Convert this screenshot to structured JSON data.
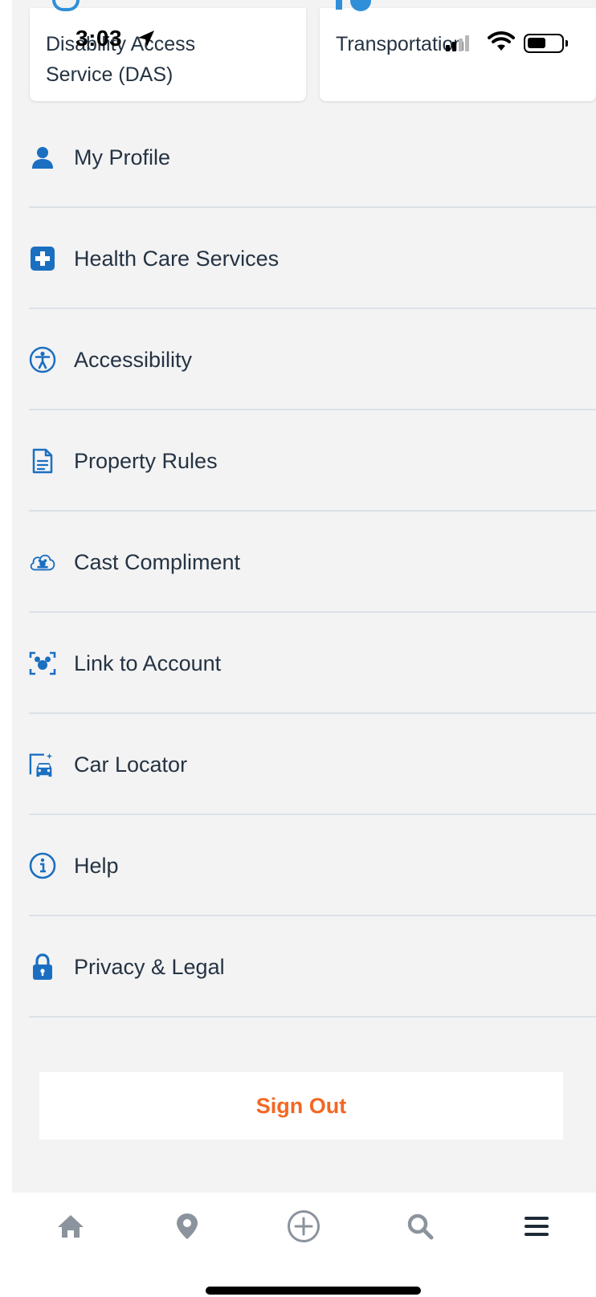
{
  "cards": {
    "das_label": "Disability Access Service (DAS)",
    "transportation_label": "Transportation"
  },
  "status_bar": {
    "time": "3:03"
  },
  "colors": {
    "accent_blue": "#1b6fc1",
    "sign_out_orange": "#f26722",
    "text_dark": "#253342",
    "background": "#f3f3f4"
  },
  "menu": {
    "items": [
      {
        "label": "My Profile",
        "icon": "person-icon"
      },
      {
        "label": "Health Care Services",
        "icon": "medical-cross-icon"
      },
      {
        "label": "Accessibility",
        "icon": "accessibility-icon"
      },
      {
        "label": "Property Rules",
        "icon": "document-icon"
      },
      {
        "label": "Cast Compliment",
        "icon": "cast-compliment-icon"
      },
      {
        "label": "Link to Account",
        "icon": "mickey-scan-icon"
      },
      {
        "label": "Car Locator",
        "icon": "car-locator-icon"
      },
      {
        "label": "Help",
        "icon": "info-icon"
      },
      {
        "label": "Privacy & Legal",
        "icon": "lock-icon"
      }
    ]
  },
  "sign_out_label": "Sign Out",
  "tabbar": {
    "tabs": [
      {
        "icon": "home-icon"
      },
      {
        "icon": "map-pin-icon"
      },
      {
        "icon": "add-circle-icon"
      },
      {
        "icon": "search-icon"
      },
      {
        "icon": "menu-icon"
      }
    ]
  }
}
